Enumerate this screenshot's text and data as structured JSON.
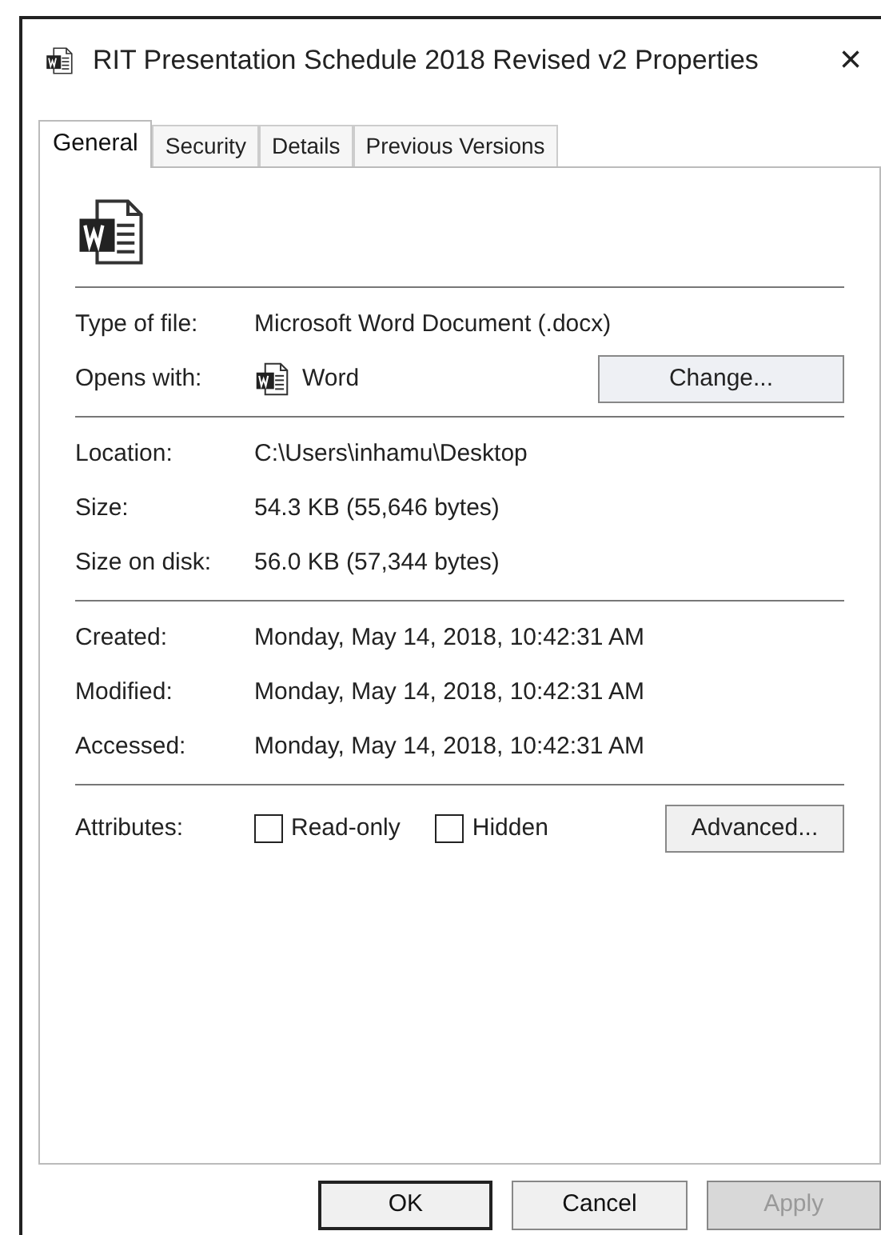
{
  "window": {
    "title": "RIT Presentation Schedule 2018 Revised v2 Properties",
    "close": "×"
  },
  "tabs": [
    {
      "label": "General",
      "selected": true
    },
    {
      "label": "Security",
      "selected": false
    },
    {
      "label": "Details",
      "selected": false
    },
    {
      "label": "Previous Versions",
      "selected": false
    }
  ],
  "groups": [
    [
      {
        "kind": "text",
        "label": "Type of file:",
        "value": "Microsoft Word Document (.docx)"
      },
      {
        "kind": "app",
        "label": "Opens with:",
        "value": "Word",
        "button": "Change..."
      }
    ],
    [
      {
        "kind": "text",
        "label": "Location:",
        "value": "C:\\Users\\inhamu\\Desktop"
      },
      {
        "kind": "text",
        "label": "Size:",
        "value": "54.3 KB (55,646 bytes)"
      },
      {
        "kind": "text",
        "label": "Size on disk:",
        "value": "56.0 KB (57,344 bytes)"
      }
    ],
    [
      {
        "kind": "text",
        "label": "Created:",
        "value": "Monday, May 14, 2018, 10:42:31 AM"
      },
      {
        "kind": "text",
        "label": "Modified:",
        "value": "Monday, May 14, 2018, 10:42:31 AM"
      },
      {
        "kind": "text",
        "label": "Accessed:",
        "value": "Monday, May 14, 2018, 10:42:31 AM"
      }
    ]
  ],
  "attributes": {
    "label": "Attributes:",
    "options": [
      {
        "label": "Read-only",
        "checked": false
      },
      {
        "label": "Hidden",
        "checked": false
      }
    ],
    "button": "Advanced..."
  },
  "buttons": [
    {
      "label": "OK",
      "default": true,
      "disabled": false
    },
    {
      "label": "Cancel",
      "default": false,
      "disabled": false
    },
    {
      "label": "Apply",
      "default": false,
      "disabled": true
    }
  ]
}
